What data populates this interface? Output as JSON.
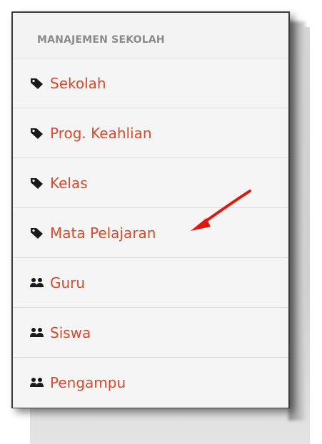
{
  "menu": {
    "header": "MANAJEMEN SEKOLAH",
    "items": [
      {
        "label": "Sekolah",
        "icon": "tag-icon"
      },
      {
        "label": "Prog. Keahlian",
        "icon": "tag-icon"
      },
      {
        "label": "Kelas",
        "icon": "tag-icon"
      },
      {
        "label": "Mata Pelajaran",
        "icon": "tag-icon"
      },
      {
        "label": "Guru",
        "icon": "users-icon"
      },
      {
        "label": "Siswa",
        "icon": "users-icon"
      },
      {
        "label": "Pengampu",
        "icon": "users-icon"
      }
    ]
  },
  "colors": {
    "link": "#d84a2b",
    "header_text": "#8a8a8a",
    "arrow": "#e3160e"
  }
}
